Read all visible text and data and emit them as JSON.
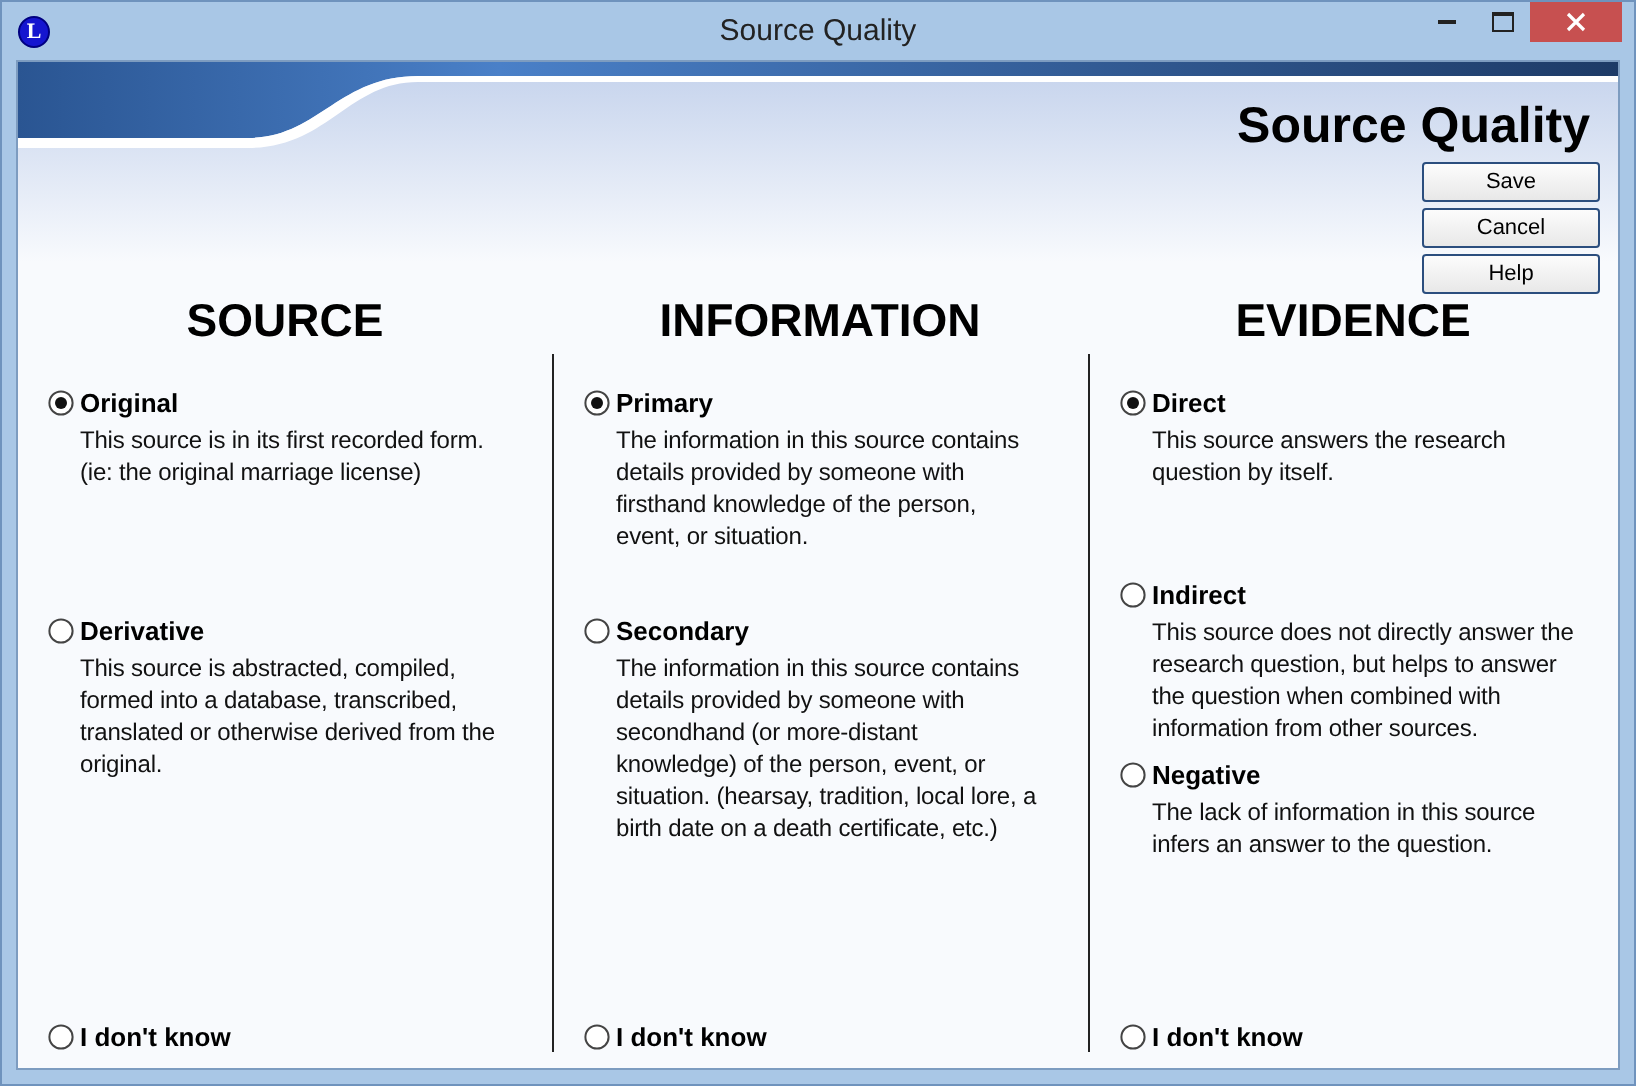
{
  "window": {
    "title": "Source Quality",
    "app_icon_letter": "L"
  },
  "header": {
    "title": "Source Quality"
  },
  "buttons": [
    {
      "label": "Save"
    },
    {
      "label": "Cancel"
    },
    {
      "label": "Help"
    }
  ],
  "columns": [
    {
      "heading": "SOURCE",
      "options": [
        {
          "label": "Original",
          "selected": true,
          "description": "This source is in its first recorded form. (ie: the original marriage license)"
        },
        {
          "label": "Derivative",
          "selected": false,
          "description": "This source is abstracted, compiled, formed into a database, transcribed, translated or otherwise derived from the original."
        },
        {
          "label": "I don't know",
          "selected": false
        }
      ]
    },
    {
      "heading": "INFORMATION",
      "options": [
        {
          "label": "Primary",
          "selected": true,
          "description": "The information in this source contains details provided by someone with firsthand knowledge of the person, event, or situation."
        },
        {
          "label": "Secondary",
          "selected": false,
          "description": "The information in this source contains details provided by someone with secondhand (or more-distant knowledge) of the person, event, or situation. (hearsay, tradition, local lore, a birth date on a death certificate, etc.)"
        },
        {
          "label": "I don't know",
          "selected": false
        }
      ]
    },
    {
      "heading": "EVIDENCE",
      "options": [
        {
          "label": "Direct",
          "selected": true,
          "description": "This source answers the research question by itself."
        },
        {
          "label": "Indirect",
          "selected": false,
          "description": "This source does not directly answer the research question, but helps to answer the question when combined with information from other sources."
        },
        {
          "label": "Negative",
          "selected": false,
          "description": "The lack of information in this source infers an answer to the question."
        },
        {
          "label": "I don't know",
          "selected": false
        }
      ]
    }
  ]
}
